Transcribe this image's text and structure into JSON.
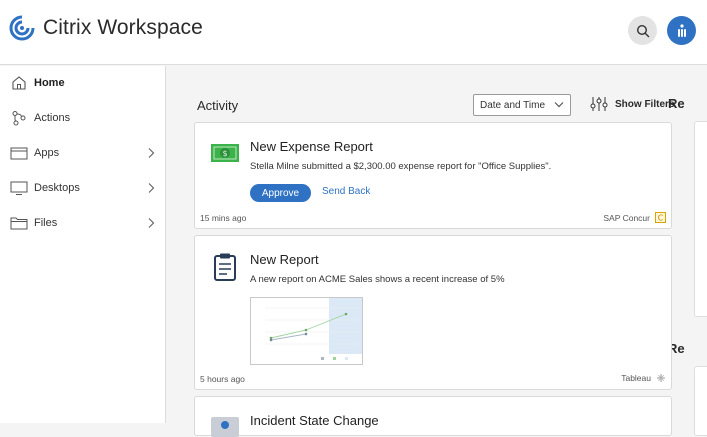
{
  "app": {
    "brand_name": "Citrix Workspace",
    "brand_color": "#2f72c4"
  },
  "header": {
    "search_icon": "search-icon",
    "avatar_icon": "user-avatar-icon"
  },
  "sidebar": {
    "items": [
      {
        "label": "Home",
        "icon": "home-icon",
        "active": true,
        "has_children": false
      },
      {
        "label": "Actions",
        "icon": "actions-icon",
        "active": false,
        "has_children": false
      },
      {
        "label": "Apps",
        "icon": "apps-icon",
        "active": false,
        "has_children": true
      },
      {
        "label": "Desktops",
        "icon": "desktop-icon",
        "active": false,
        "has_children": true
      },
      {
        "label": "Files",
        "icon": "folder-icon",
        "active": false,
        "has_children": true
      }
    ]
  },
  "activity": {
    "title": "Activity",
    "sort_value": "Date and Time",
    "filters_label": "Show Filters"
  },
  "right_panel": {
    "title_1": "Re",
    "title_2": "Re"
  },
  "cards": [
    {
      "icon": "money-icon",
      "title": "New Expense Report",
      "description": "Stella Milne submitted a $2,300.00 expense report for \"Office Supplies\".",
      "primary_action": "Approve",
      "secondary_action": "Send Back",
      "time": "15 mins ago",
      "source": "SAP Concur"
    },
    {
      "icon": "clipboard-report-icon",
      "title": "New Report",
      "description": "A new report on ACME Sales shows a recent increase of 5%",
      "time": "5 hours ago",
      "source": "Tableau"
    },
    {
      "icon": "incident-icon",
      "title": "Incident State Change"
    }
  ]
}
